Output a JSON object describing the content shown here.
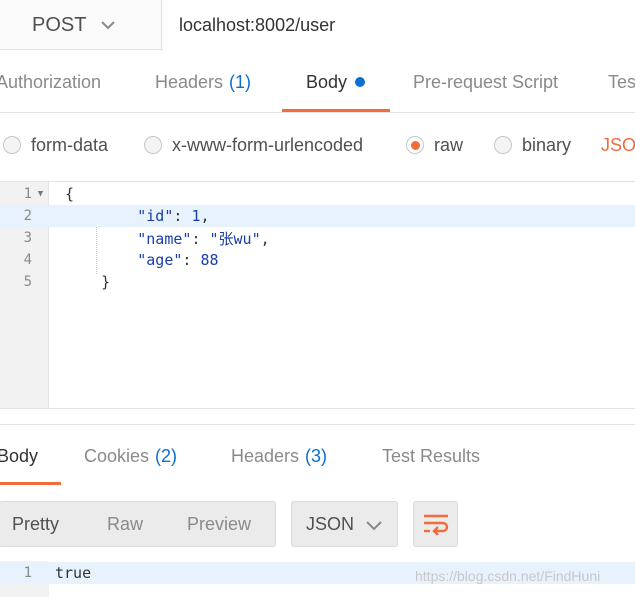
{
  "request": {
    "method": "POST",
    "url": "localhost:8002/user"
  },
  "request_tabs": [
    {
      "label": "Authorization",
      "count": ""
    },
    {
      "label": "Headers",
      "count": "(1)"
    },
    {
      "label": "Body",
      "count": ""
    },
    {
      "label": "Pre-request Script",
      "count": ""
    },
    {
      "label": "Tes",
      "count": ""
    }
  ],
  "body_types": [
    {
      "label": "form-data",
      "selected": false
    },
    {
      "label": "x-www-form-urlencoded",
      "selected": false
    },
    {
      "label": "raw",
      "selected": true
    },
    {
      "label": "binary",
      "selected": false
    }
  ],
  "body_format": "JSON",
  "editor": {
    "line_numbers": [
      "1",
      "2",
      "3",
      "4",
      "5"
    ],
    "lines": {
      "open": "{",
      "id_key": "\"id\"",
      "id_val": "1",
      "name_key": "\"name\"",
      "name_val": "\"张wu\"",
      "age_key": "\"age\"",
      "age_val": "88",
      "close": "}"
    }
  },
  "response_tabs": [
    {
      "label": "Body",
      "count": ""
    },
    {
      "label": "Cookies",
      "count": "(2)"
    },
    {
      "label": "Headers",
      "count": "(3)"
    },
    {
      "label": "Test Results",
      "count": ""
    }
  ],
  "view_modes": [
    "Pretty",
    "Raw",
    "Preview"
  ],
  "response_format": "JSON",
  "response": {
    "line_number": "1",
    "text": "true"
  },
  "watermark": "https://blog.csdn.net/FindHuni",
  "colors": {
    "accent": "#f26b3a",
    "link_blue": "#0c6fd3"
  }
}
